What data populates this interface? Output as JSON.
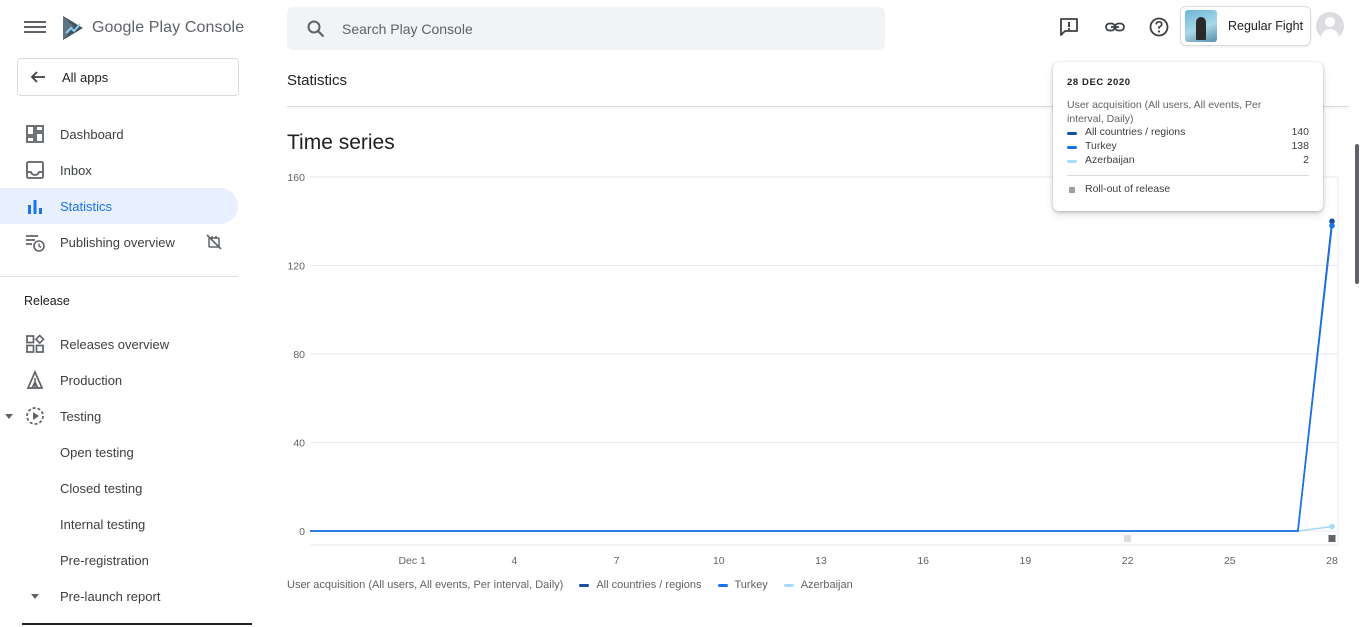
{
  "app": {
    "logo_text_main": "Google Play",
    "logo_text_sub": "Console"
  },
  "sidebar": {
    "all_apps_label": "All apps",
    "items": [
      {
        "label": "Dashboard"
      },
      {
        "label": "Inbox"
      },
      {
        "label": "Statistics"
      },
      {
        "label": "Publishing overview"
      }
    ],
    "release_section": "Release",
    "release_items": [
      {
        "label": "Releases overview"
      },
      {
        "label": "Production"
      },
      {
        "label": "Testing"
      },
      {
        "label": "Open testing"
      },
      {
        "label": "Closed testing"
      },
      {
        "label": "Internal testing"
      },
      {
        "label": "Pre-registration"
      },
      {
        "label": "Pre-launch report"
      }
    ]
  },
  "header": {
    "search_placeholder": "Search Play Console",
    "app_name": "Regular Fight"
  },
  "main": {
    "page_title": "Statistics",
    "section_heading": "Time series",
    "legend_description": "User acquisition (All users, All events, Per interval, Daily)"
  },
  "tooltip": {
    "date": "28 DEC 2020",
    "metric": "User acquisition (All users, All events, Per interval, Daily)",
    "rows": [
      {
        "name": "All countries / regions",
        "value": "140",
        "color": "#174ea6"
      },
      {
        "name": "Turkey",
        "value": "138",
        "color": "#1a73e8"
      },
      {
        "name": "Azerbaijan",
        "value": "2",
        "color": "#a8dbf5"
      }
    ],
    "rollout_label": "Roll-out of release"
  },
  "chart_data": {
    "type": "line",
    "title": "Time series",
    "ylim": [
      0,
      160
    ],
    "y_ticks": [
      0,
      40,
      80,
      120,
      160
    ],
    "x_tick_labels": [
      "Dec 1",
      "4",
      "7",
      "10",
      "13",
      "16",
      "19",
      "22",
      "25",
      "28"
    ],
    "x_range": [
      "2020-11-28",
      "2020-12-28"
    ],
    "series": [
      {
        "name": "All countries / regions",
        "color": "#174ea6",
        "points": [
          [
            "2020-11-28",
            0
          ],
          [
            "2020-12-27",
            0
          ],
          [
            "2020-12-28",
            140
          ]
        ]
      },
      {
        "name": "Turkey",
        "color": "#1a73e8",
        "points": [
          [
            "2020-11-28",
            0
          ],
          [
            "2020-12-27",
            0
          ],
          [
            "2020-12-28",
            138
          ]
        ]
      },
      {
        "name": "Azerbaijan",
        "color": "#a8dbf5",
        "points": [
          [
            "2020-11-28",
            0
          ],
          [
            "2020-12-27",
            0
          ],
          [
            "2020-12-28",
            2
          ]
        ]
      }
    ],
    "release_markers": [
      {
        "date": "2020-12-22",
        "color": "#dadce0"
      },
      {
        "date": "2020-12-28",
        "color": "#5f6368"
      }
    ],
    "grid": true,
    "legend_position": "bottom"
  }
}
